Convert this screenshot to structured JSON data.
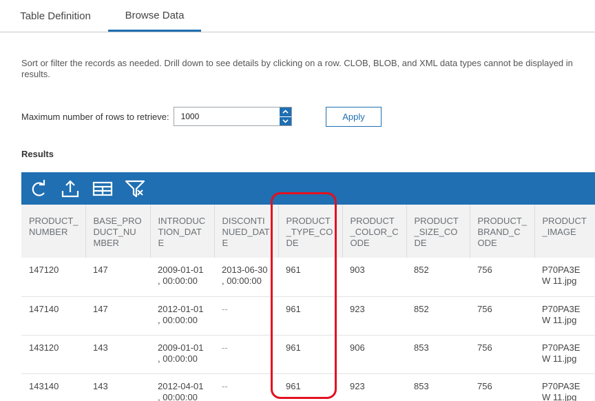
{
  "tabs": [
    {
      "label": "Table Definition"
    },
    {
      "label": "Browse Data"
    }
  ],
  "description": "Sort or filter the records as needed. Drill down to see details by clicking on a row. CLOB, BLOB, and XML data types cannot be displayed in results.",
  "max_rows": {
    "label": "Maximum number of rows to retrieve:",
    "value": "1000"
  },
  "apply_label": "Apply",
  "results_title": "Results",
  "toolbar": {
    "icons": [
      "refresh-icon",
      "export-icon",
      "columns-icon",
      "filter-icon"
    ]
  },
  "columns": [
    "PRODUCT_NUMBER",
    "BASE_PRODUCT_NUMBER",
    "INTRODUCTION_DATE",
    "DISCONTINUED_DATE",
    "PRODUCT_TYPE_CODE",
    "PRODUCT_COLOR_CODE",
    "PRODUCT_SIZE_CODE",
    "PRODUCT_BRAND_CODE",
    "PRODUCT_IMAGE"
  ],
  "rows": [
    [
      "147120",
      "147",
      "2009-01-01 , 00:00:00",
      "2013-06-30 , 00:00:00",
      "961",
      "903",
      "852",
      "756",
      "P70PA3EW 11.jpg"
    ],
    [
      "147140",
      "147",
      "2012-01-01 , 00:00:00",
      "--",
      "961",
      "923",
      "852",
      "756",
      "P70PA3EW 11.jpg"
    ],
    [
      "143120",
      "143",
      "2009-01-01 , 00:00:00",
      "--",
      "961",
      "906",
      "853",
      "756",
      "P70PA3EW 11.jpg"
    ],
    [
      "143140",
      "143",
      "2012-04-01 , 00:00:00",
      "--",
      "961",
      "923",
      "853",
      "756",
      "P70PA3EW 11.jpg"
    ]
  ],
  "colors": {
    "accent": "#1f6fb2",
    "highlight": "#e3101f",
    "header_bg": "#f2f2f2"
  }
}
